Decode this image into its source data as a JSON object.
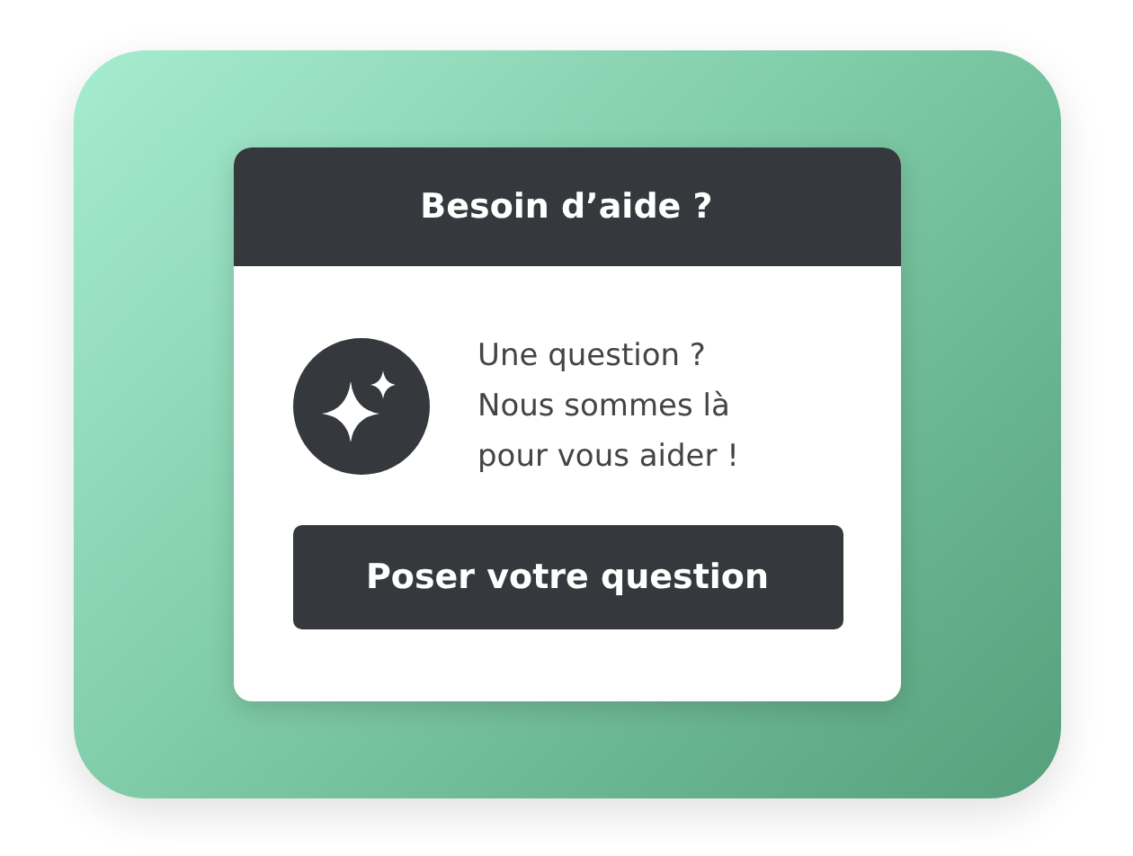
{
  "dialog": {
    "title": "Besoin d’aide ?",
    "message_lines": [
      "Une question ?",
      "Nous sommes là",
      "pour vous aider !"
    ],
    "button": "Poser votre question"
  }
}
